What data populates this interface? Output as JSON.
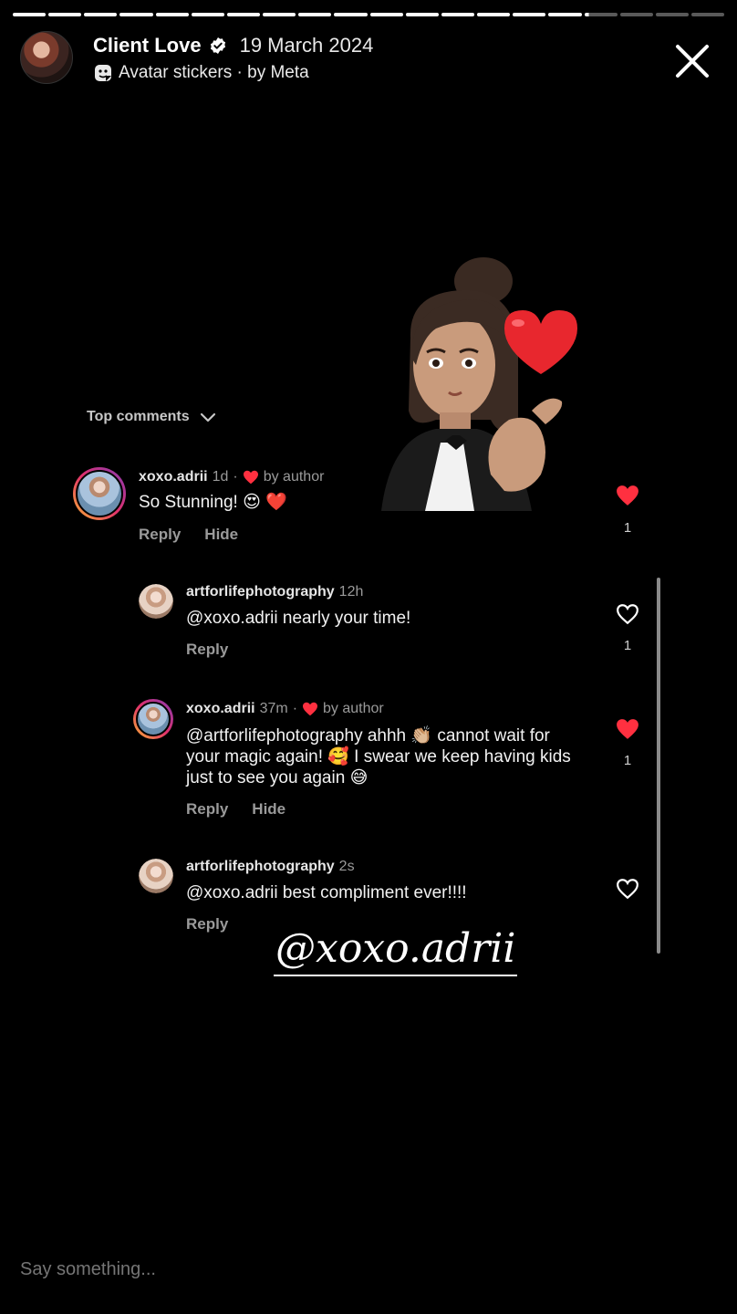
{
  "story": {
    "title": "Client Love",
    "date": "19 March 2024",
    "subtitle": "Avatar stickers · by Meta",
    "progress_segments": 20,
    "progress_current_segment": 17
  },
  "comments_header": {
    "label": "Top comments"
  },
  "comments": [
    {
      "user": "xoxo.adrii",
      "time": "1d",
      "liked_by_author": true,
      "by_author_label": "by author",
      "text": "So Stunning! 😍 ❤️",
      "actions": [
        "Reply",
        "Hide"
      ],
      "liked": true,
      "like_count": "1"
    },
    {
      "user": "artforlifephotography",
      "time": "12h",
      "liked_by_author": false,
      "text": "@xoxo.adrii nearly your time!",
      "actions": [
        "Reply"
      ],
      "liked": false,
      "like_count": "1"
    },
    {
      "user": "xoxo.adrii",
      "time": "37m",
      "liked_by_author": true,
      "by_author_label": "by author",
      "text": "@artforlifephotography ahhh 👏🏼 cannot wait for your magic again! 🥰 I swear we keep having kids just to see you again 😅",
      "actions": [
        "Reply",
        "Hide"
      ],
      "liked": true,
      "like_count": "1"
    },
    {
      "user": "artforlifephotography",
      "time": "2s",
      "liked_by_author": false,
      "text": "@xoxo.adrii best compliment ever!!!!",
      "actions": [
        "Reply"
      ],
      "liked": false,
      "like_count": ""
    }
  ],
  "mention_sticker": "@xoxo.adrii",
  "reply": {
    "placeholder": "Say something..."
  },
  "colors": {
    "heart": "#ff3040",
    "background": "#000000",
    "muted": "#9a9a9a"
  }
}
